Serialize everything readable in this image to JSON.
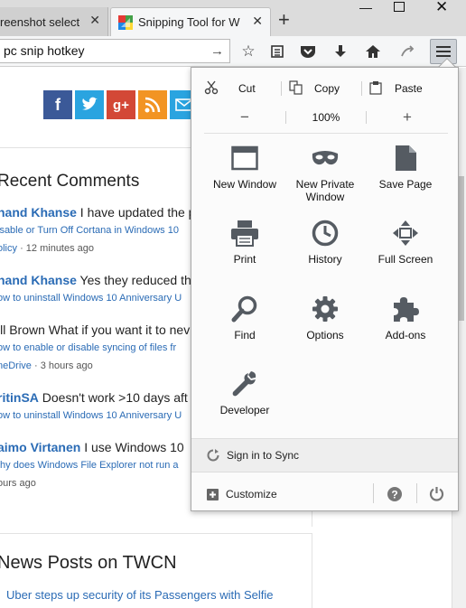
{
  "tabs": [
    {
      "title": "reenshot select",
      "active": false
    },
    {
      "title": "Snipping Tool for W",
      "active": true
    }
  ],
  "urlbar": {
    "value": "pc snip hotkey"
  },
  "page": {
    "recent_comments_title": "Recent Comments",
    "comments": [
      {
        "author": "nand Khanse",
        "text": " I have updated the p",
        "link": "isable or Turn Off Cortana in Windows 10",
        "link2": "olicy",
        "time": "12 minutes ago"
      },
      {
        "author": "nand Khanse",
        "text": " Yes they reduced th",
        "link": "ow to uninstall Windows 10 Anniversary U"
      },
      {
        "author": "",
        "text": "ill Brown What if you want it to nev",
        "link": "ow to enable or disable syncing of files fr",
        "link2": "neDrive",
        "time": "3 hours ago"
      },
      {
        "author": "ritinSA",
        "text": " Doesn't work >10 days aft",
        "link": "ow to uninstall Windows 10 Anniversary U"
      },
      {
        "author": "aimo Virtanen",
        "text": " I use Windows 10",
        "link": "/hy does Windows File Explorer not run a",
        "link2": "ours ago"
      }
    ],
    "news_title": "News Posts on TWCN",
    "news_link": "Uber steps up security of its Passengers with Selfie"
  },
  "menu": {
    "edit": {
      "cut": "Cut",
      "copy": "Copy",
      "paste": "Paste"
    },
    "zoom": {
      "minus": "−",
      "value": "100%",
      "plus": "+"
    },
    "items": [
      {
        "label": "New Window",
        "icon": "new-window-icon"
      },
      {
        "label": "New Private Window",
        "icon": "private-mask-icon"
      },
      {
        "label": "Save Page",
        "icon": "save-page-icon"
      },
      {
        "label": "Print",
        "icon": "printer-icon"
      },
      {
        "label": "History",
        "icon": "history-clock-icon"
      },
      {
        "label": "Full Screen",
        "icon": "fullscreen-icon"
      },
      {
        "label": "Find",
        "icon": "magnifier-icon"
      },
      {
        "label": "Options",
        "icon": "gear-icon"
      },
      {
        "label": "Add-ons",
        "icon": "puzzle-icon"
      },
      {
        "label": "Developer",
        "icon": "wrench-icon"
      }
    ],
    "sync": "Sign in to Sync",
    "customize": "Customize"
  },
  "colors": {
    "link": "#2a6bb5",
    "panel_bg": "#fbfbfb",
    "icon_gray": "#555b62"
  }
}
